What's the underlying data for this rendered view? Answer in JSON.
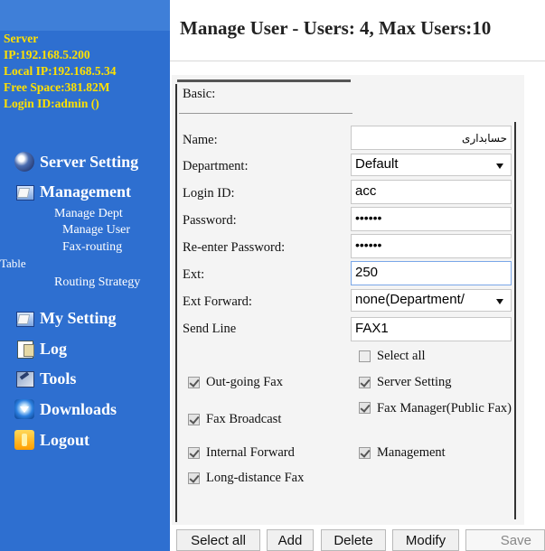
{
  "sidebar": {
    "server_info": {
      "server_label": "Server",
      "ip": "IP:192.168.5.200",
      "local_ip": "Local IP:192.168.5.34",
      "free_space": "Free Space:381.82M",
      "login_id": "Login ID:admin ()"
    },
    "nav": {
      "server_setting": "Server Setting",
      "management": "Management",
      "manage_dept": "Manage Dept",
      "manage_user": "Manage User",
      "fax_routing": "Fax-routing",
      "table": "Table",
      "routing_strategy": "Routing Strategy",
      "my_setting": "My Setting",
      "log": "Log",
      "tools": "Tools",
      "downloads": "Downloads",
      "logout": "Logout"
    },
    "icons": [
      "server-icon",
      "folder-icon",
      "folder-icon",
      "log-icon",
      "tools-icon",
      "download-icon",
      "logout-icon"
    ]
  },
  "header": {
    "title": "Manage User - Users: 4, Max Users:10"
  },
  "form": {
    "section_label": "Basic:",
    "name_label": "Name:",
    "name_value": "حسابداری",
    "department_label": "Department:",
    "department_value": "Default",
    "login_id_label": "Login ID:",
    "login_id_value": "acc",
    "password_label": "Password:",
    "password_value": "••••••",
    "reenter_password_label": "Re-enter Password:",
    "reenter_password_value": "••••••",
    "ext_label": "Ext:",
    "ext_value": "250",
    "ext_forward_label": "Ext Forward:",
    "ext_forward_value": "none(Department/",
    "send_line_label": "Send Line",
    "send_line_value": "FAX1"
  },
  "permissions": {
    "select_all": {
      "label": "Select all",
      "checked": false
    },
    "outgoing_fax": {
      "label": "Out-going Fax",
      "checked": true
    },
    "server_setting": {
      "label": "Server Setting",
      "checked": true
    },
    "fax_broadcast": {
      "label": "Fax Broadcast",
      "checked": true
    },
    "fax_manager": {
      "label": "Fax Manager(Public Fax)",
      "checked": true
    },
    "internal_forward": {
      "label": "Internal Forward",
      "checked": true
    },
    "management": {
      "label": "Management",
      "checked": true
    },
    "long_distance_fax": {
      "label": "Long-distance Fax",
      "checked": true
    }
  },
  "buttons": {
    "select_all": "Select all",
    "add": "Add",
    "delete": "Delete",
    "modify": "Modify",
    "save": "Save"
  },
  "colors": {
    "sidebar_bg": "#2e6fd0",
    "sidebar_info_text": "#ffe100",
    "sidebar_nav_text": "#ffffff"
  }
}
